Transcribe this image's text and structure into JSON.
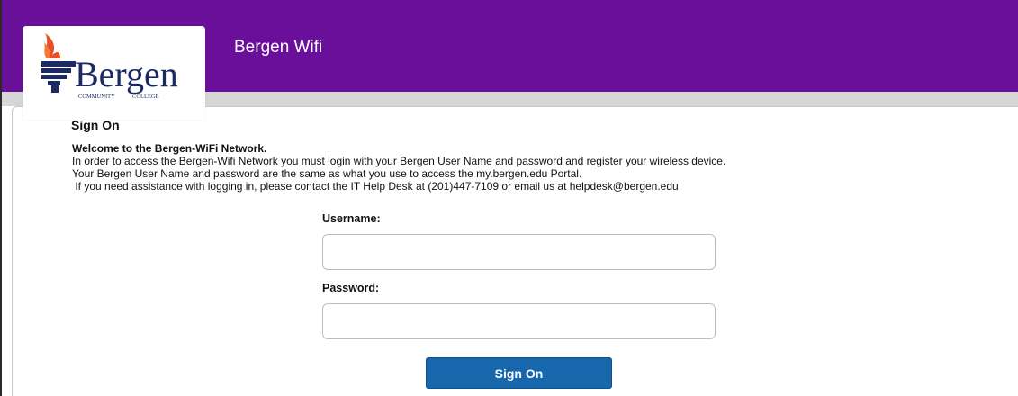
{
  "header": {
    "title": "Bergen Wifi",
    "background_color": "#6a0f9a"
  },
  "logo": {
    "name": "Bergen",
    "tagline_left": "COMMUNITY",
    "tagline_right": "COLLEGE",
    "flame_color": "#e8502a",
    "text_color": "#1b2a63"
  },
  "signon": {
    "heading": "Sign On",
    "welcome": "Welcome to the Bergen-WiFi Network.",
    "line1": "In order to access the Bergen-Wifi Network you must login with your Bergen User Name and password and register your wireless device.",
    "line2": "Your Bergen User Name and password are the same as what you use to access the my.bergen.edu Portal.",
    "line3": " If you need assistance with logging in, please contact the IT Help Desk at (201)447-7109 or email us at helpdesk@bergen.edu"
  },
  "form": {
    "username_label": "Username:",
    "username_value": "",
    "password_label": "Password:",
    "password_value": "",
    "submit_label": "Sign On",
    "button_color": "#1767ad"
  }
}
